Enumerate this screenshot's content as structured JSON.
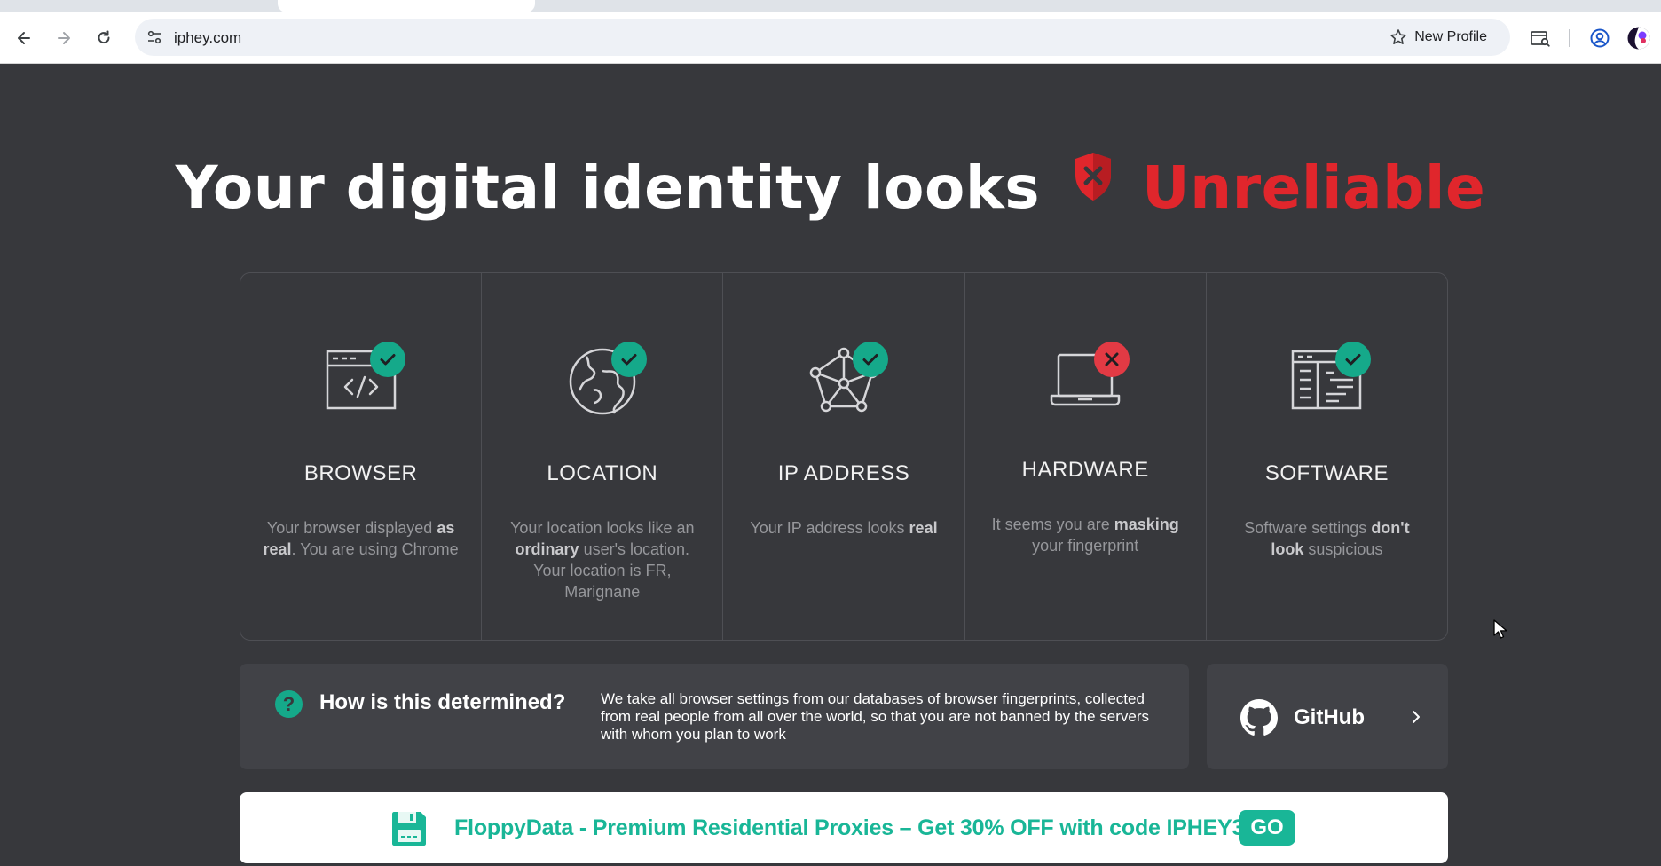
{
  "browser": {
    "url": "iphey.com",
    "profile_label": "New Profile",
    "icons": [
      "back-icon",
      "forward-icon",
      "reload-icon",
      "site-info-icon",
      "star-icon",
      "tab-search-icon",
      "account-icon",
      "profile-avatar-icon"
    ]
  },
  "headline": {
    "prefix": "Your digital identity looks",
    "status": "Unreliable",
    "status_color": "#e0262c"
  },
  "cards": [
    {
      "key": "browser",
      "title": "BROWSER",
      "status": "ok",
      "icon": "browser-code-icon",
      "desc": [
        {
          "t": "Your browser displayed "
        },
        {
          "b": "as real"
        },
        {
          "t": ". You are using Chrome"
        }
      ]
    },
    {
      "key": "location",
      "title": "LOCATION",
      "status": "ok",
      "icon": "globe-icon",
      "desc": [
        {
          "t": "Your location looks like an "
        },
        {
          "b": "ordinary"
        },
        {
          "t": " user's location. Your location is FR, Marignane"
        }
      ]
    },
    {
      "key": "ip",
      "title": "IP ADDRESS",
      "status": "ok",
      "icon": "network-icon",
      "desc": [
        {
          "t": "Your IP address looks "
        },
        {
          "b": "real"
        }
      ]
    },
    {
      "key": "hardware",
      "title": "HARDWARE",
      "status": "bad",
      "icon": "laptop-icon",
      "desc": [
        {
          "t": "It seems you are "
        },
        {
          "b": "masking"
        },
        {
          "t": " your fingerprint"
        }
      ]
    },
    {
      "key": "software",
      "title": "SOFTWARE",
      "status": "ok",
      "icon": "software-window-icon",
      "desc": [
        {
          "t": "Software settings "
        },
        {
          "b": "don't look"
        },
        {
          "t": " suspicious"
        }
      ]
    }
  ],
  "how": {
    "title": "How is this determined?",
    "text": "We take all browser settings from our databases of browser fingerprints, collected from real people from all over the world, so that you are not banned by the servers with whom you plan to work"
  },
  "github": {
    "label": "GitHub"
  },
  "promo": {
    "text": "FloppyData - Premium Residential Proxies – Get 30% OFF with code IPHEY30",
    "button": "GO"
  },
  "colors": {
    "ok": "#15a98a",
    "bad": "#e23a44",
    "accent": "#19b697",
    "background": "#37383c"
  }
}
